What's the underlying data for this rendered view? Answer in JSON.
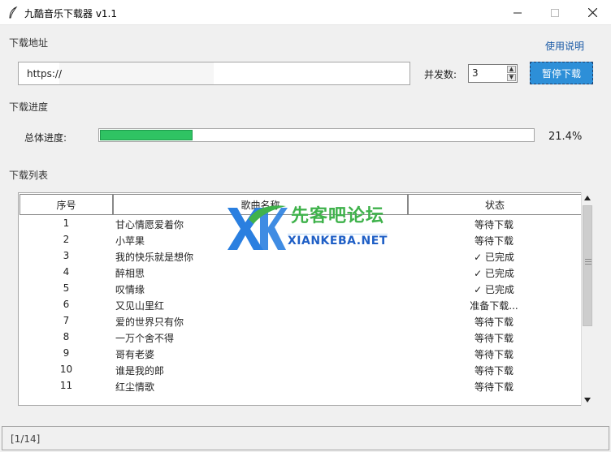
{
  "window": {
    "title": "九酷音乐下载器 v1.1"
  },
  "url_section": {
    "label": "下载地址",
    "help_link": "使用说明",
    "url_value": "https://"
  },
  "concurrency": {
    "label": "并发数:",
    "value": "3"
  },
  "buttons": {
    "pause": "暂停下载"
  },
  "progress_section": {
    "label": "下载进度",
    "overall_label": "总体进度:",
    "percent_text": "21.4%",
    "fraction": 0.214
  },
  "list_section": {
    "label": "下载列表",
    "columns": [
      "序号",
      "歌曲名称",
      "状态"
    ],
    "rows": [
      {
        "index": "1",
        "name": "甘心情愿爱着你",
        "status": "等待下载"
      },
      {
        "index": "2",
        "name": "小苹果",
        "status": "等待下载"
      },
      {
        "index": "3",
        "name": "我的快乐就是想你",
        "status": "✓ 已完成"
      },
      {
        "index": "4",
        "name": "醉相思",
        "status": "✓ 已完成"
      },
      {
        "index": "5",
        "name": "叹情缘",
        "status": "✓ 已完成"
      },
      {
        "index": "6",
        "name": "又见山里红",
        "status": "准备下载..."
      },
      {
        "index": "7",
        "name": "爱的世界只有你",
        "status": "等待下载"
      },
      {
        "index": "8",
        "name": "一万个舍不得",
        "status": "等待下载"
      },
      {
        "index": "9",
        "name": "哥有老婆",
        "status": "等待下载"
      },
      {
        "index": "10",
        "name": "谁是我的郎",
        "status": "等待下载"
      },
      {
        "index": "11",
        "name": "红尘情歌",
        "status": "等待下载"
      }
    ]
  },
  "watermark": {
    "title": "先客吧论坛",
    "subtitle": "XIANKEBA.NET"
  },
  "status_bar": {
    "text": "[1/14]"
  },
  "colors": {
    "accent": "#2d8fd8",
    "progress": "#2fc363",
    "link": "#1a5aa6"
  }
}
